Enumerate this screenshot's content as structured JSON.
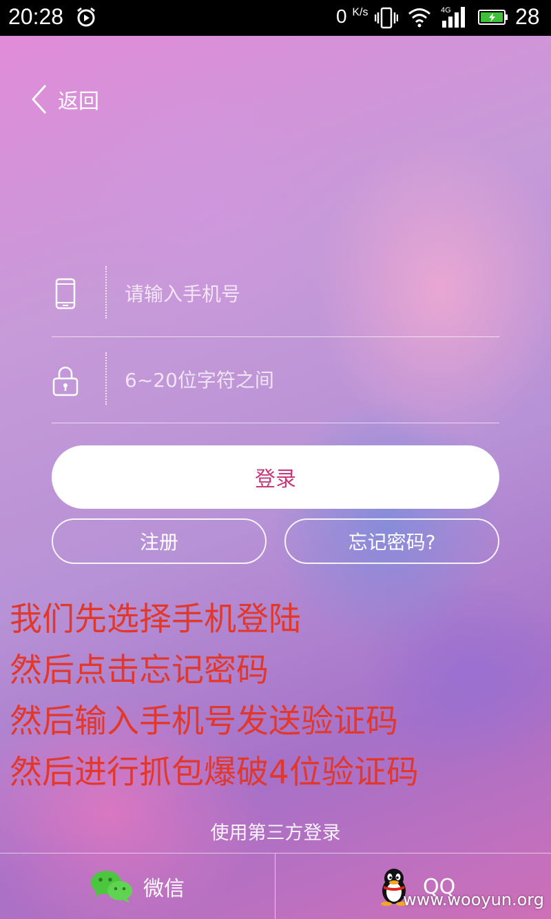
{
  "status_bar": {
    "time": "20:28",
    "net_speed": "0",
    "net_speed_unit": "K/s",
    "network_type": "4G",
    "battery_level": "28",
    "icons": [
      "alarm-icon",
      "vibrate-icon",
      "wifi-icon",
      "signal-icon",
      "battery-charging-icon"
    ]
  },
  "header": {
    "back_label": "返回"
  },
  "form": {
    "phone_placeholder": "请输入手机号",
    "password_placeholder": "6~20位字符之间",
    "login_label": "登录",
    "register_label": "注册",
    "forgot_label": "忘记密码?"
  },
  "annotation": {
    "lines": [
      "我们先选择手机登陆",
      "然后点击忘记密码",
      "然后输入手机号发送验证码",
      "然后进行抓包爆破4位验证码"
    ]
  },
  "third_party": {
    "title": "使用第三方登录",
    "wechat_label": "微信",
    "qq_label": "QQ"
  },
  "watermark": "www.wooyun.org",
  "colors": {
    "accent": "#c43a7c",
    "annotation": "#e2382c",
    "wechat": "#4cc63f"
  }
}
